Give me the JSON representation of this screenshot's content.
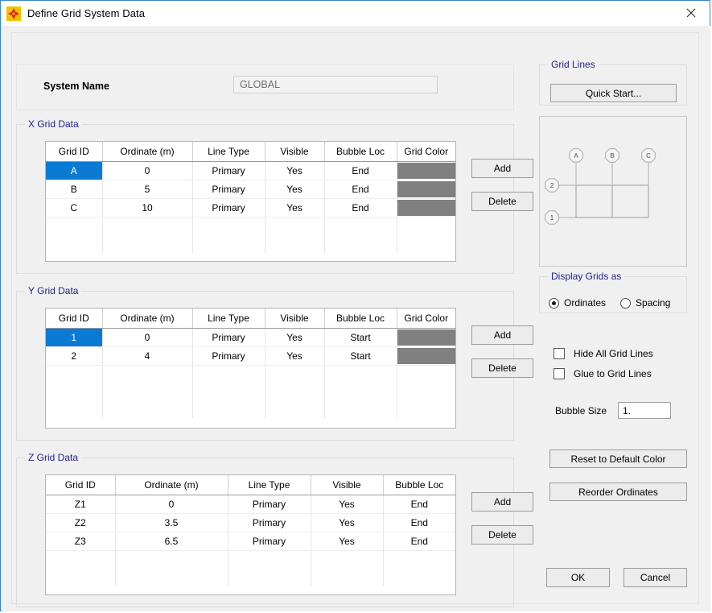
{
  "window": {
    "title": "Define Grid System Data",
    "app_icon": "sap-star-icon",
    "close_icon": "close-icon"
  },
  "system_name": {
    "label": "System Name",
    "value": "GLOBAL",
    "placeholder": "GLOBAL"
  },
  "columns_full": [
    "Grid ID",
    "Ordinate (m)",
    "Line Type",
    "Visible",
    "Bubble Loc",
    "Grid Color"
  ],
  "columns_z": [
    "Grid ID",
    "Ordinate (m)",
    "Line Type",
    "Visible",
    "Bubble Loc"
  ],
  "x_grid": {
    "title": "X Grid Data",
    "columns": [
      "Grid ID",
      "Ordinate (m)",
      "Line Type",
      "Visible",
      "Bubble Loc",
      "Grid Color"
    ],
    "rows": [
      {
        "grid_id": "A",
        "ordinate": "0",
        "line_type": "Primary",
        "visible": "Yes",
        "bubble_loc": "End",
        "grid_color": "#808080",
        "selected": true
      },
      {
        "grid_id": "B",
        "ordinate": "5",
        "line_type": "Primary",
        "visible": "Yes",
        "bubble_loc": "End",
        "grid_color": "#808080",
        "selected": false
      },
      {
        "grid_id": "C",
        "ordinate": "10",
        "line_type": "Primary",
        "visible": "Yes",
        "bubble_loc": "End",
        "grid_color": "#808080",
        "selected": false
      }
    ],
    "add_label": "Add",
    "delete_label": "Delete"
  },
  "y_grid": {
    "title": "Y Grid Data",
    "columns": [
      "Grid ID",
      "Ordinate (m)",
      "Line Type",
      "Visible",
      "Bubble Loc",
      "Grid Color"
    ],
    "rows": [
      {
        "grid_id": "1",
        "ordinate": "0",
        "line_type": "Primary",
        "visible": "Yes",
        "bubble_loc": "Start",
        "grid_color": "#808080",
        "selected": true
      },
      {
        "grid_id": "2",
        "ordinate": "4",
        "line_type": "Primary",
        "visible": "Yes",
        "bubble_loc": "Start",
        "grid_color": "#808080",
        "selected": false
      }
    ],
    "add_label": "Add",
    "delete_label": "Delete"
  },
  "z_grid": {
    "title": "Z Grid Data",
    "columns": [
      "Grid ID",
      "Ordinate (m)",
      "Line Type",
      "Visible",
      "Bubble Loc"
    ],
    "rows": [
      {
        "grid_id": "Z1",
        "ordinate": "0",
        "line_type": "Primary",
        "visible": "Yes",
        "bubble_loc": "End",
        "selected": false
      },
      {
        "grid_id": "Z2",
        "ordinate": "3.5",
        "line_type": "Primary",
        "visible": "Yes",
        "bubble_loc": "End",
        "selected": false
      },
      {
        "grid_id": "Z3",
        "ordinate": "6.5",
        "line_type": "Primary",
        "visible": "Yes",
        "bubble_loc": "End",
        "selected": false
      }
    ],
    "add_label": "Add",
    "delete_label": "Delete"
  },
  "grid_lines": {
    "title": "Grid Lines",
    "quick_start_label": "Quick Start..."
  },
  "preview": {
    "x_bubbles": [
      "A",
      "B",
      "C"
    ],
    "y_bubbles": [
      "2",
      "1"
    ]
  },
  "display_grids": {
    "title": "Display Grids as",
    "options": [
      "Ordinates",
      "Spacing"
    ],
    "selected": "Ordinates"
  },
  "options": {
    "hide_all_grid_lines": {
      "label": "Hide All Grid Lines",
      "checked": false
    },
    "glue_to_grid_lines": {
      "label": "Glue to Grid Lines",
      "checked": false
    }
  },
  "bubble_size": {
    "label": "Bubble Size",
    "value": "1."
  },
  "actions": {
    "reset_color_label": "Reset to Default Color",
    "reorder_label": "Reorder Ordinates",
    "ok_label": "OK",
    "cancel_label": "Cancel"
  },
  "colors": {
    "selection_blue": "#0b7ad4",
    "grid_color_swatch": "#808080",
    "group_label": "#22228c",
    "window_border": "#3b84c4"
  }
}
